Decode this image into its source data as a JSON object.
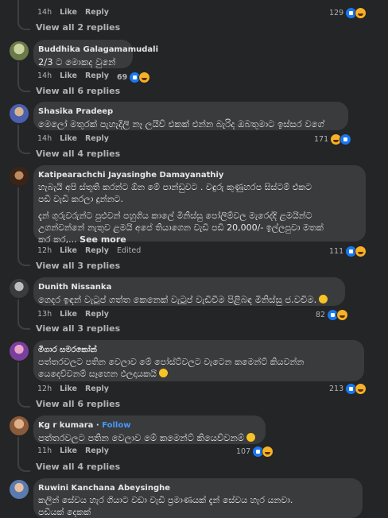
{
  "reaction_colors": {
    "like": "#1877f2",
    "haha": "#f7b125"
  },
  "top": {
    "time": "14h",
    "like": "Like",
    "reply": "Reply",
    "count": "129",
    "view_replies": "View all 2 replies"
  },
  "comments": [
    {
      "author": "Buddhika Galagamamudali",
      "text": "2/3 ට මොකද වුනේ",
      "time": "14h",
      "like": "Like",
      "reply": "Reply",
      "count": "69",
      "view_replies": "View all 6 replies"
    },
    {
      "author": "Shasika Pradeep",
      "text": "මෙලෝ මතුරක් පැහැදිලි නෑ ලයිව් එකක් එන්න බැරිද ඔබතුමාට ඉස්සර වගේ",
      "time": "14h",
      "like": "Like",
      "reply": "Reply",
      "count": "171",
      "view_replies": "View all 4 replies"
    },
    {
      "author": "Katipearachchi Jayasinghe Damayanathiy",
      "text_p1": "හැබැයි අපි ස්තූති කරන්ට ඕන මේ පාන්ඩුවට . වඳුරු කුණුහරප සිස්ටම් එකට\nපඩි වැඩි කරලා දුන්නට.",
      "text_p2": "දැන් ගුරුවරුන්ට පුළුවන් පහුගිය කාලේ මිනිස්සු පෝලිම්වල මැරෙද්දි ළමයින්ට\nඋගන්වන්නේ නැතුව ළමයි අපේ තියාගෙන වැඩි පඩි 20,000/- ඉල්ලපුවා මතක්\nකර කර,... ",
      "see_more": "See more",
      "time": "12h",
      "like": "Like",
      "reply": "Reply",
      "edited": "Edited",
      "count": "111",
      "view_replies": "View all 3 replies"
    },
    {
      "author": "Dunith Nissanka",
      "text": "ගෙදර ඉඳන් වැටුප් ගත්ත කෙනෙක් වැටුප් වැඩිවීම පිළිබඳ මිනිස්සු ජ.වචිම.",
      "time": "13h",
      "like": "Like",
      "reply": "Reply",
      "count": "82",
      "view_replies": "View all 3 replies"
    },
    {
      "author": "මිගාර සමරකෝන්",
      "text": "පත්තරවලට පතින වෙලාව මේ පෝස්ට්වලට වැටෙන කමෙන්ට් කියවන්න\nයෙදෙව්වනම් සෑහෙන ඵලදායකයි",
      "time": "12h",
      "like": "Like",
      "reply": "Reply",
      "count": "213",
      "view_replies": "View all 6 replies"
    },
    {
      "author": "Kg r kumara",
      "follow_sep": " · ",
      "follow": "Follow",
      "text": "පත්තරවලට පතින වෙලාව මේ කමෙන්ට් කියෙව්වනම්",
      "time": "11h",
      "like": "Like",
      "reply": "Reply",
      "count": "107",
      "view_replies": "View all 4 replies"
    },
    {
      "author": "Ruwini Kanchana Abeysinghe",
      "text": "කලින් සේවය හැර ගියාට වඩා වැඩි ප්‍රමාණයක් දැන් සේවය හැර යනවා.\nපඩියක් දෙකක්"
    }
  ]
}
